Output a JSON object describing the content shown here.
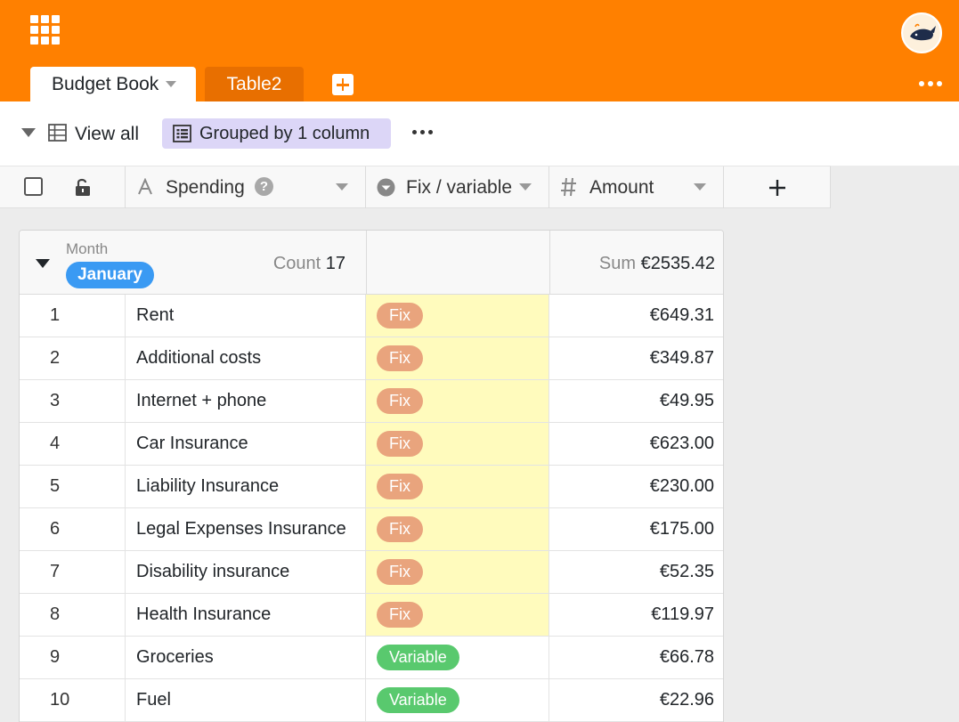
{
  "header": {
    "tabs": [
      {
        "label": "Budget Book",
        "active": true
      },
      {
        "label": "Table2",
        "active": false
      }
    ],
    "accent_color": "#ff8000"
  },
  "toolbar": {
    "view_label": "View all",
    "grouped_label": "Grouped by 1 column"
  },
  "columns": {
    "spending": "Spending",
    "fix_variable": "Fix / variable",
    "amount": "Amount",
    "help_glyph": "?"
  },
  "group": {
    "field_label": "Month",
    "value": "January",
    "count_label": "Count",
    "count": "17",
    "sum_label": "Sum",
    "sum": "€2535.42"
  },
  "rows": [
    {
      "n": "1",
      "spending": "Rent",
      "type": "Fix",
      "amount": "€649.31"
    },
    {
      "n": "2",
      "spending": "Additional costs",
      "type": "Fix",
      "amount": "€349.87"
    },
    {
      "n": "3",
      "spending": "Internet + phone",
      "type": "Fix",
      "amount": "€49.95"
    },
    {
      "n": "4",
      "spending": "Car Insurance",
      "type": "Fix",
      "amount": "€623.00"
    },
    {
      "n": "5",
      "spending": "Liability Insurance",
      "type": "Fix",
      "amount": "€230.00"
    },
    {
      "n": "6",
      "spending": "Legal Expenses Insurance",
      "type": "Fix",
      "amount": "€175.00"
    },
    {
      "n": "7",
      "spending": "Disability insurance",
      "type": "Fix",
      "amount": "€52.35"
    },
    {
      "n": "8",
      "spending": "Health Insurance",
      "type": "Fix",
      "amount": "€119.97"
    },
    {
      "n": "9",
      "spending": "Groceries",
      "type": "Variable",
      "amount": "€66.78"
    },
    {
      "n": "10",
      "spending": "Fuel",
      "type": "Variable",
      "amount": "€22.96"
    }
  ],
  "colors": {
    "fix_pill": "#e9a47d",
    "variable_pill": "#59c96e",
    "month_chip": "#3a9af3",
    "fix_highlight": "#fffbbd"
  }
}
